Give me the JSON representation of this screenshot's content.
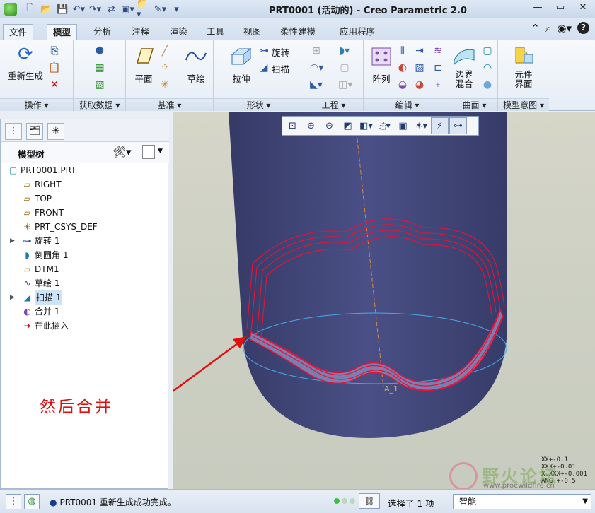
{
  "window": {
    "title": "PRT0001 (活动的) - Creo Parametric 2.0",
    "controls": [
      "minimize-icon",
      "restore-icon",
      "close-icon"
    ]
  },
  "quick_access": [
    "new-icon",
    "open-icon",
    "save-icon",
    "undo-icon",
    "redo-icon",
    "regenerate-icon",
    "windows-icon",
    "folder-icon",
    "measure-icon",
    "customize-icon"
  ],
  "tabs": [
    {
      "label": "文件",
      "name": "tab-file"
    },
    {
      "label": "模型",
      "name": "tab-model",
      "active": true
    },
    {
      "label": "分析",
      "name": "tab-analysis"
    },
    {
      "label": "注释",
      "name": "tab-annotate"
    },
    {
      "label": "渲染",
      "name": "tab-render"
    },
    {
      "label": "工具",
      "name": "tab-tools"
    },
    {
      "label": "视图",
      "name": "tab-view"
    },
    {
      "label": "柔性建模",
      "name": "tab-flexible-modeling"
    },
    {
      "label": "应用程序",
      "name": "tab-applications"
    }
  ],
  "ribbon": {
    "groups": {
      "operations": "操作 ▾",
      "get_data": "获取数据 ▾",
      "datum": "基准 ▾",
      "shapes": "形状 ▾",
      "engineering": "工程 ▾",
      "editing": "编辑 ▾",
      "surfaces": "曲面 ▾",
      "model_intent": "模型意图 ▾"
    },
    "buttons": {
      "regenerate": "重新生成",
      "plane": "平面",
      "sketch": "草绘",
      "extrude": "拉伸",
      "revolve": "旋转",
      "sweep": "扫描",
      "pattern": "阵列",
      "boundary_blend_1": "边界",
      "boundary_blend_2": "混合",
      "component_interface_1": "元件",
      "component_interface_2": "界面"
    }
  },
  "model_tree": {
    "header": "模型树",
    "items": [
      {
        "label": "PRT0001.PRT",
        "icon": "part-icon",
        "expandable": false,
        "level": 0
      },
      {
        "label": "RIGHT",
        "icon": "datum-plane-icon",
        "expandable": false,
        "level": 1
      },
      {
        "label": "TOP",
        "icon": "datum-plane-icon",
        "expandable": false,
        "level": 1
      },
      {
        "label": "FRONT",
        "icon": "datum-plane-icon",
        "expandable": false,
        "level": 1
      },
      {
        "label": "PRT_CSYS_DEF",
        "icon": "csys-icon",
        "expandable": false,
        "level": 1
      },
      {
        "label": "旋转 1",
        "icon": "revolve-icon",
        "expandable": true,
        "level": 1
      },
      {
        "label": "倒圆角 1",
        "icon": "round-icon",
        "expandable": false,
        "level": 1
      },
      {
        "label": "DTM1",
        "icon": "datum-plane-icon",
        "expandable": false,
        "level": 1
      },
      {
        "label": "草绘 1",
        "icon": "sketch-icon",
        "expandable": false,
        "level": 1
      },
      {
        "label": "扫描 1",
        "icon": "sweep-icon",
        "expandable": true,
        "level": 1,
        "selected": true
      },
      {
        "label": "合并 1",
        "icon": "merge-icon",
        "expandable": false,
        "level": 1
      },
      {
        "label": "在此插入",
        "icon": "insert-arrow-icon",
        "expandable": false,
        "level": 1
      }
    ]
  },
  "viewport": {
    "annotation": "然后合并",
    "axis_label": "A_1",
    "tolerances": [
      "XX+-0.1",
      "XXX+-0.01",
      "X.XXX+-0.001",
      "ANG +-0.5"
    ],
    "watermark_1": "野火论坛",
    "watermark_2": "www.proewildfire.cn"
  },
  "statusbar": {
    "message": "PRT0001 重新生成成功完成。",
    "selection": "选择了 1 项",
    "filter": "智能"
  },
  "colors": {
    "model_body": "#3e4474",
    "curve_red": "#e0143c",
    "annotation_red": "#e01010",
    "background": "#d3d5c8"
  }
}
